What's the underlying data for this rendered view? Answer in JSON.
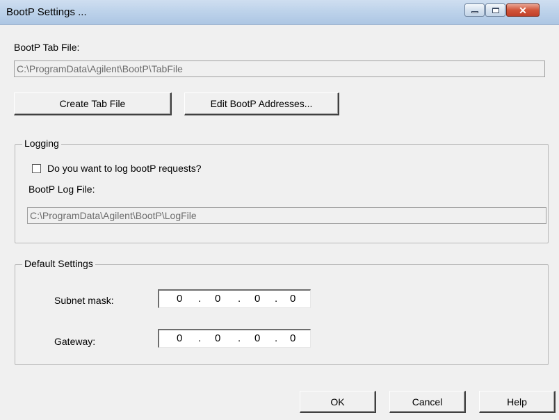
{
  "window": {
    "title": "BootP Settings ...",
    "controls": {
      "minimize": "minimize-icon",
      "maximize": "maximize-icon",
      "close": "close-icon"
    }
  },
  "tab_file": {
    "label": "BootP Tab File:",
    "value": "C:\\ProgramData\\Agilent\\BootP\\TabFile",
    "create_button": "Create Tab File",
    "edit_button": "Edit BootP Addresses..."
  },
  "logging": {
    "legend": "Logging",
    "checkbox_label": "Do you want to log bootP requests?",
    "checkbox_checked": false,
    "log_file_label": "BootP Log File:",
    "log_file_value": "C:\\ProgramData\\Agilent\\BootP\\LogFile"
  },
  "defaults": {
    "legend": "Default Settings",
    "subnet_label": "Subnet mask:",
    "subnet_octets": [
      "0",
      "0",
      "0",
      "0"
    ],
    "gateway_label": "Gateway:",
    "gateway_octets": [
      "0",
      "0",
      "0",
      "0"
    ],
    "separator": "."
  },
  "footer": {
    "ok": "OK",
    "cancel": "Cancel",
    "help": "Help"
  }
}
